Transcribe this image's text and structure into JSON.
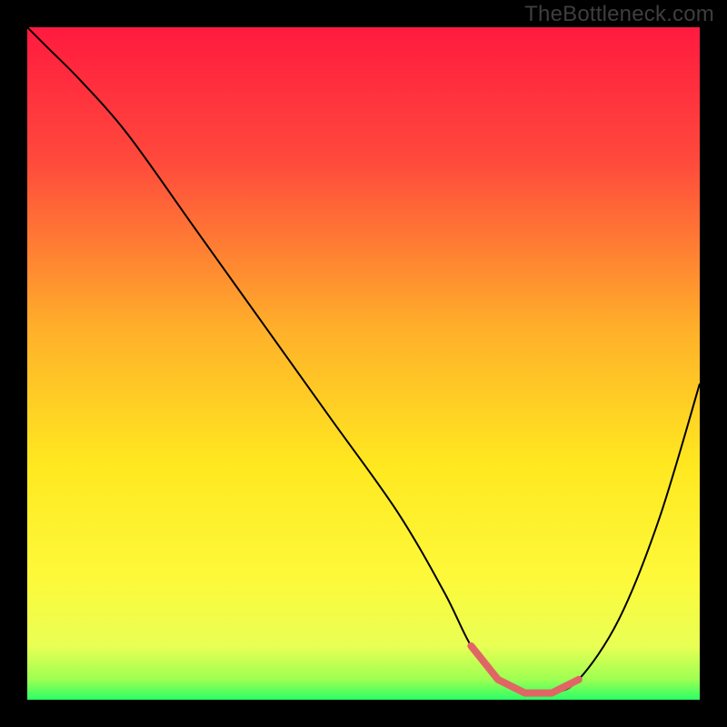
{
  "watermark": "TheBottleneck.com",
  "chart_data": {
    "type": "line",
    "title": "",
    "xlabel": "",
    "ylabel": "",
    "xlim": [
      0,
      100
    ],
    "ylim": [
      0,
      100
    ],
    "series": [
      {
        "name": "bottleneck-curve",
        "color": "#000000",
        "x": [
          0,
          3,
          8,
          15,
          25,
          35,
          45,
          55,
          62,
          66,
          70,
          74,
          78,
          82,
          88,
          94,
          100
        ],
        "y": [
          100,
          97,
          92,
          84,
          70,
          56,
          42,
          28,
          16,
          8,
          3,
          1,
          1,
          3,
          12,
          27,
          47
        ]
      }
    ],
    "highlight": {
      "name": "flat-minimum",
      "color": "#e06666",
      "x": [
        66,
        70,
        74,
        78,
        82
      ],
      "y": [
        8,
        3,
        1,
        1,
        3
      ]
    },
    "background_gradient": {
      "stops": [
        {
          "offset": 0.0,
          "color": "#ff1a3f"
        },
        {
          "offset": 0.2,
          "color": "#ff4a3c"
        },
        {
          "offset": 0.45,
          "color": "#ffb02a"
        },
        {
          "offset": 0.65,
          "color": "#ffe820"
        },
        {
          "offset": 0.82,
          "color": "#fdf93a"
        },
        {
          "offset": 0.92,
          "color": "#e9ff54"
        },
        {
          "offset": 0.97,
          "color": "#9dff52"
        },
        {
          "offset": 1.0,
          "color": "#2bff66"
        }
      ]
    }
  }
}
